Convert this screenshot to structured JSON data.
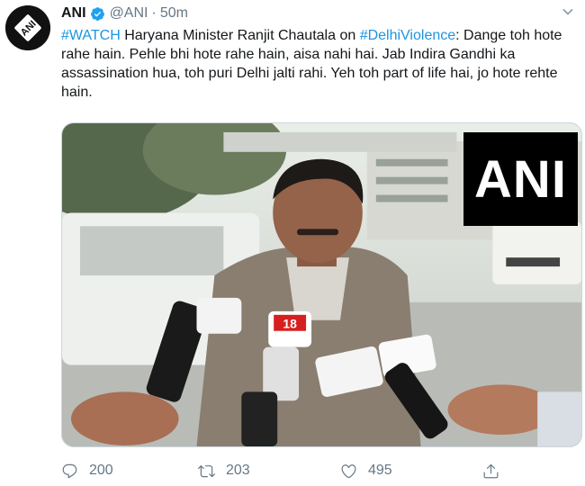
{
  "tweet": {
    "author": {
      "name": "ANI",
      "handle": "@ANI",
      "separator": "·",
      "time": "50m",
      "avatar_logo_text": "ANI"
    },
    "text": {
      "hashtag1": "#WATCH",
      "part1": " Haryana Minister Ranjit Chautala on ",
      "hashtag2": "#DelhiViolence",
      "part2": ": Dange toh hote rahe hain. Pehle bhi hote rahe hain, aisa nahi hai. Jab Indira Gandhi ka assassination hua, toh puri Delhi jalti rahi. Yeh toh part of life hai, jo hote rehte hain."
    },
    "media": {
      "watermark": "ANI",
      "mic_badge": "18"
    },
    "actions": {
      "replies": "200",
      "retweets": "203",
      "likes": "495"
    }
  },
  "colors": {
    "link": "#1b95e0",
    "muted": "#657786",
    "verified": "#1da1f2",
    "text": "#14171a"
  },
  "icons": {
    "reply": "reply-icon",
    "retweet": "retweet-icon",
    "like": "heart-icon",
    "share": "share-icon",
    "verified": "verified-badge-icon",
    "caret": "chevron-down-icon"
  }
}
